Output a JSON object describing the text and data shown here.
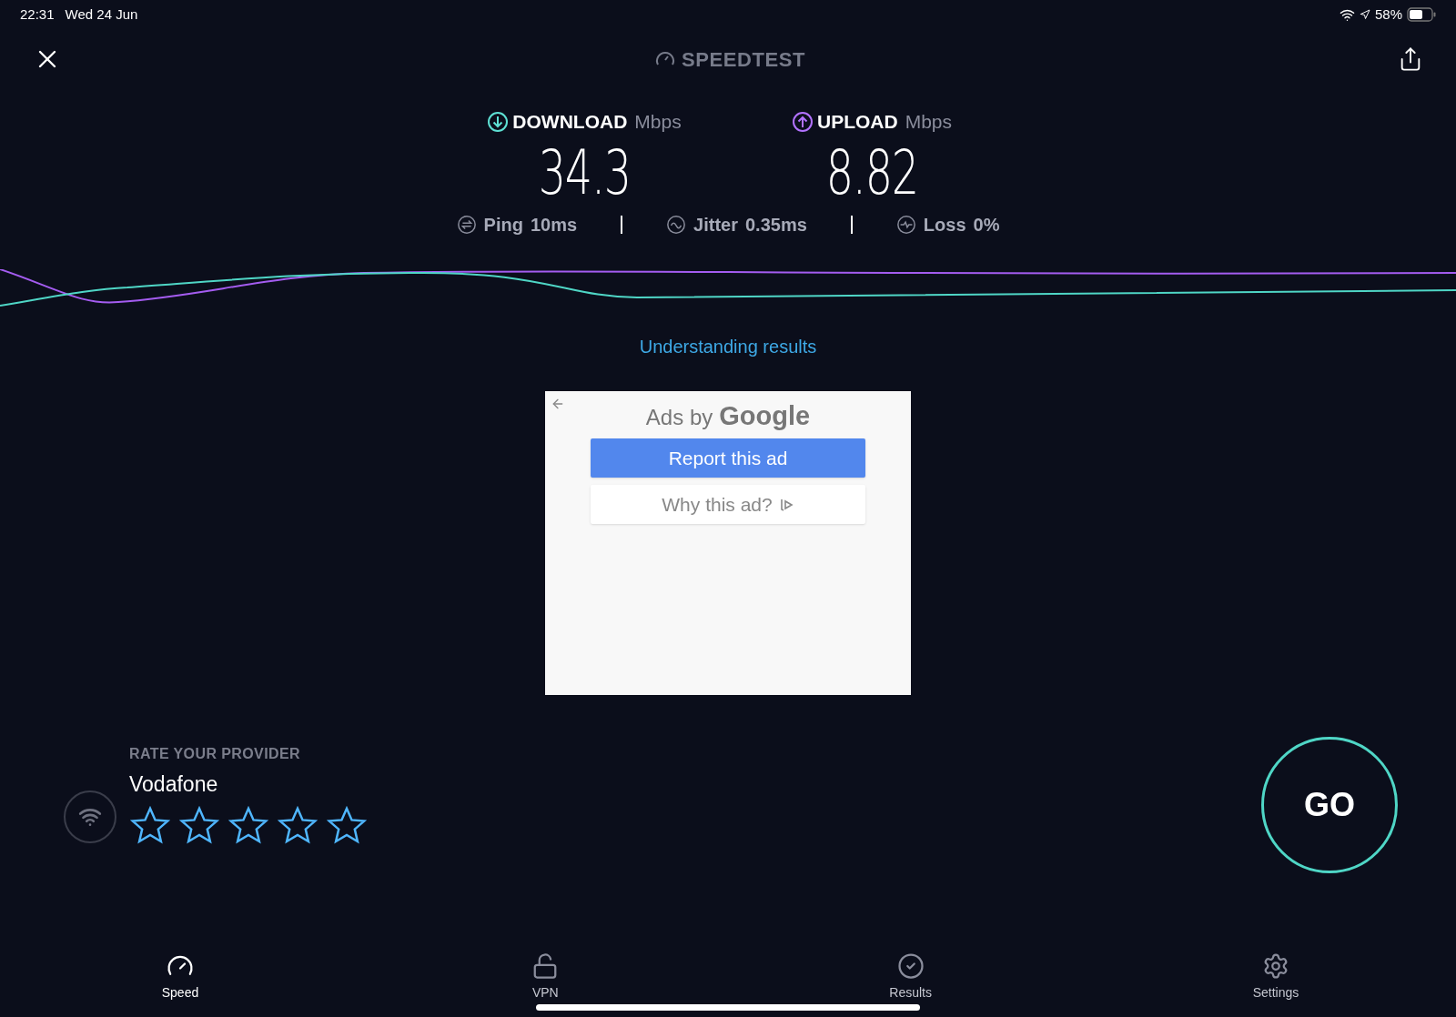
{
  "status_bar": {
    "time": "22:31",
    "date": "Wed 24 Jun",
    "battery": "58%"
  },
  "header": {
    "title": "SPEEDTEST"
  },
  "results": [
    {
      "kind": "download",
      "label": "DOWNLOAD",
      "unit": "Mbps",
      "value": "34.3"
    },
    {
      "kind": "upload",
      "label": "UPLOAD",
      "unit": "Mbps",
      "value": "8.82"
    }
  ],
  "metrics": [
    {
      "kind": "ping",
      "label": "Ping",
      "value": "10ms"
    },
    {
      "kind": "jitter",
      "label": "Jitter",
      "value": "0.35ms"
    },
    {
      "kind": "loss",
      "label": "Loss",
      "value": "0%"
    }
  ],
  "link": "Understanding results",
  "ad": {
    "heading": "Ads by",
    "brand": "Google",
    "report_button": "Report this ad",
    "why_button": "Why this ad?"
  },
  "rating": {
    "heading": "RATE YOUR PROVIDER",
    "provider": "Vodafone",
    "stars": 0
  },
  "go_button": "GO",
  "tabs": [
    {
      "kind": "speed",
      "label": "Speed",
      "selected": true
    },
    {
      "kind": "vpn",
      "label": "VPN",
      "selected": false
    },
    {
      "kind": "results",
      "label": "Results",
      "selected": false
    },
    {
      "kind": "settings",
      "label": "Settings",
      "selected": false
    }
  ]
}
